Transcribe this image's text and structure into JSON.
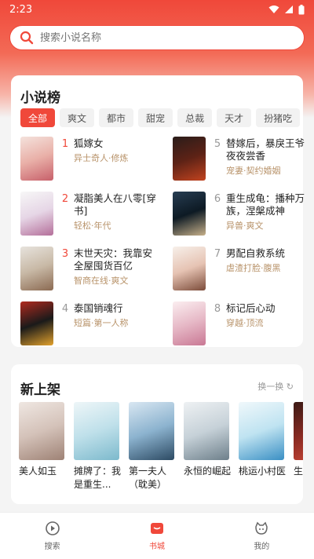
{
  "status": {
    "time": "2:23"
  },
  "search": {
    "placeholder": "搜索小说名称"
  },
  "rank": {
    "title": "小说榜",
    "tabs": [
      "全部",
      "爽文",
      "都市",
      "甜宠",
      "总裁",
      "天才",
      "扮猪吃"
    ],
    "items": [
      {
        "num": "1",
        "name": "狐嫁女",
        "tag": "异士奇人·修炼"
      },
      {
        "num": "2",
        "name": "凝脂美人在八零[穿书]",
        "tag": "轻松·年代"
      },
      {
        "num": "3",
        "name": "末世天灾：我靠安全屋囤货百亿",
        "tag": "智商在线·爽文"
      },
      {
        "num": "4",
        "name": "泰国销魂行",
        "tag": "短篇·第一人称"
      },
      {
        "num": "5",
        "name": "替嫁后，暴戾王爷夜夜尝香",
        "tag": "宠妻·契约婚姻"
      },
      {
        "num": "6",
        "name": "重生成龟：播种万族，涅槃成神",
        "tag": "异兽·爽文"
      },
      {
        "num": "7",
        "name": "男配自救系统",
        "tag": "虐渣打脸·腹黑"
      },
      {
        "num": "8",
        "name": "标记后心动",
        "tag": "穿越·顶流"
      }
    ]
  },
  "new_shelf": {
    "title": "新上架",
    "refresh_label": "换一换",
    "items": [
      {
        "title": "美人如玉"
      },
      {
        "title": "摊牌了：我是重生..."
      },
      {
        "title": "第一夫人（耽美）"
      },
      {
        "title": "永恒的崛起"
      },
      {
        "title": "桃运小村医"
      },
      {
        "title": "生"
      }
    ]
  },
  "nav": {
    "items": [
      {
        "label": "搜索"
      },
      {
        "label": "书城"
      },
      {
        "label": "我的"
      }
    ]
  },
  "colors": {
    "accent": "#f0483a",
    "tag": "#b8936a"
  }
}
